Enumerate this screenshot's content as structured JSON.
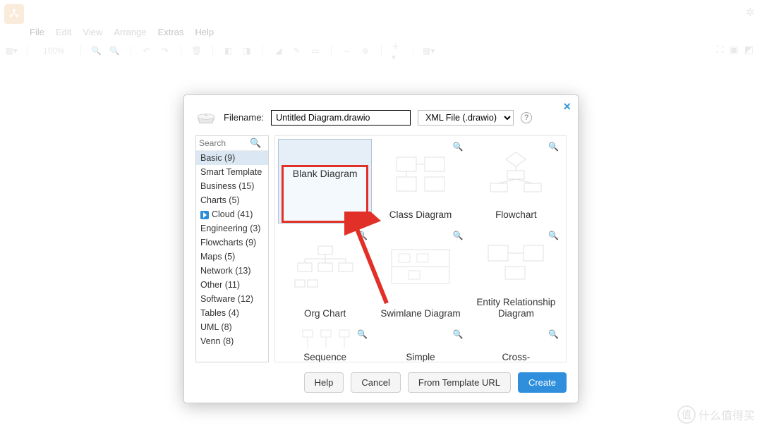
{
  "menu": {
    "file": "File",
    "edit": "Edit",
    "view": "View",
    "arrange": "Arrange",
    "extras": "Extras",
    "help": "Help"
  },
  "toolbar": {
    "zoom": "100%"
  },
  "dialog": {
    "filename_label": "Filename:",
    "filename_value": "Untitled Diagram.drawio",
    "format": "XML File (.drawio)",
    "search_placeholder": "Search"
  },
  "categories": [
    {
      "label": "Basic (9)",
      "selected": true
    },
    {
      "label": "Smart Template"
    },
    {
      "label": "Business (15)"
    },
    {
      "label": "Charts (5)"
    },
    {
      "label": "Cloud (41)",
      "cloud": true
    },
    {
      "label": "Engineering (3)"
    },
    {
      "label": "Flowcharts (9)"
    },
    {
      "label": "Maps (5)"
    },
    {
      "label": "Network (13)"
    },
    {
      "label": "Other (11)"
    },
    {
      "label": "Software (12)"
    },
    {
      "label": "Tables (4)"
    },
    {
      "label": "UML (8)"
    },
    {
      "label": "Venn (8)"
    }
  ],
  "templates": {
    "r1c1": "Blank Diagram",
    "r1c2": "Class Diagram",
    "r1c3": "Flowchart",
    "r2c1": "Org Chart",
    "r2c2": "Swimlane Diagram",
    "r2c3": "Entity Relationship Diagram",
    "r3c1": "Sequence",
    "r3c2": "Simple",
    "r3c3": "Cross-"
  },
  "buttons": {
    "help": "Help",
    "cancel": "Cancel",
    "from_url": "From Template URL",
    "create": "Create"
  },
  "watermark": "什么值得买"
}
